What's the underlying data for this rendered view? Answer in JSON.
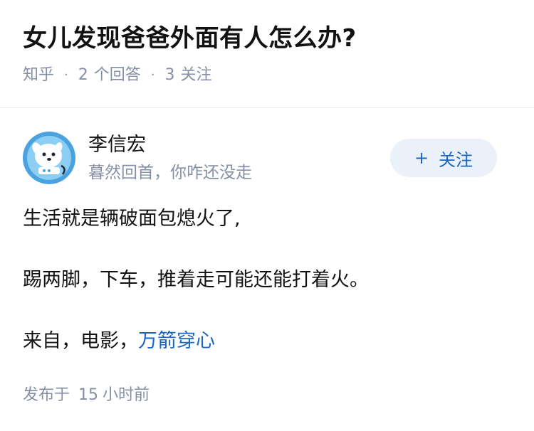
{
  "question": {
    "title": "女儿发现爸爸外面有人怎么办?",
    "source": "知乎",
    "separator": "·",
    "answers_count": "2",
    "answers_label": "个回答",
    "follows_count": "3",
    "follows_label": "关注"
  },
  "author": {
    "name": "李信宏",
    "headline": "暮然回首，你咋还没走",
    "avatar_icon": "avatar-icon"
  },
  "follow_button": {
    "plus": "+",
    "label": "关注",
    "bg_color": "#ebf1fa",
    "text_color": "#1a66c2"
  },
  "content": {
    "line1": "生活就是辆破面包熄火了,",
    "line2": "踢两脚，下车，推着走可能还能打着火。",
    "line3_prefix": "来自，电影，",
    "line3_link": "万箭穿心"
  },
  "footer": {
    "published_label": "发布于",
    "time_value": "15",
    "time_unit": "小时前"
  },
  "colors": {
    "link": "#1a66c2",
    "meta": "#8590a6",
    "text": "#121212"
  }
}
